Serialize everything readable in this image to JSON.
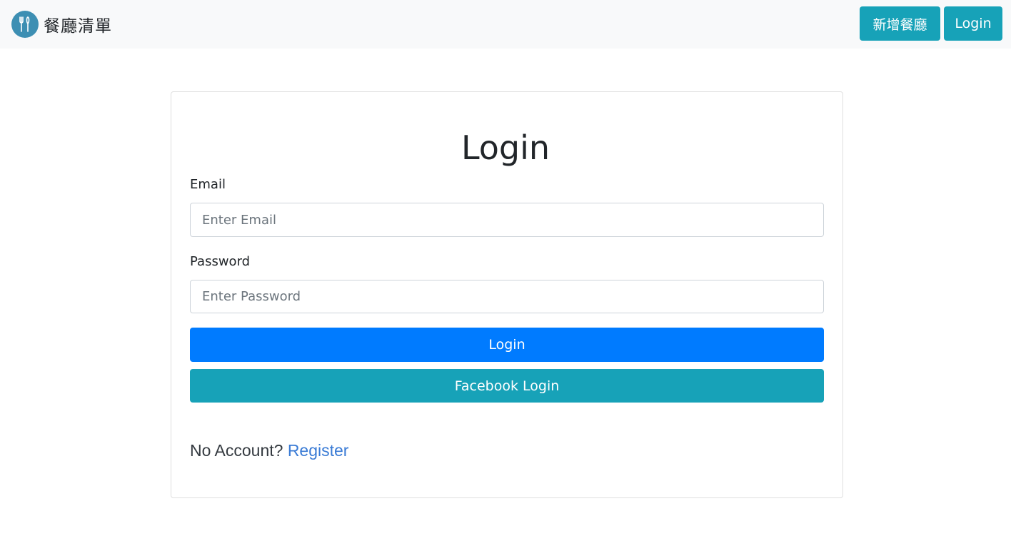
{
  "navbar": {
    "brand_text": "餐廳清單",
    "brand_icon": "fork-knife-icon",
    "add_restaurant_label": "新增餐廳",
    "login_label": "Login"
  },
  "form": {
    "title": "Login",
    "email_label": "Email",
    "email_placeholder": "Enter Email",
    "email_value": "",
    "password_label": "Password",
    "password_placeholder": "Enter Password",
    "password_value": "",
    "login_button": "Login",
    "facebook_button": "Facebook Login",
    "no_account_text": "No Account? ",
    "register_link": "Register"
  },
  "colors": {
    "navbar_bg": "#f8f9fa",
    "info": "#17a2b8",
    "primary": "#007bff",
    "link": "#3a7bd5",
    "brand_logo": "#3d8fb3"
  }
}
